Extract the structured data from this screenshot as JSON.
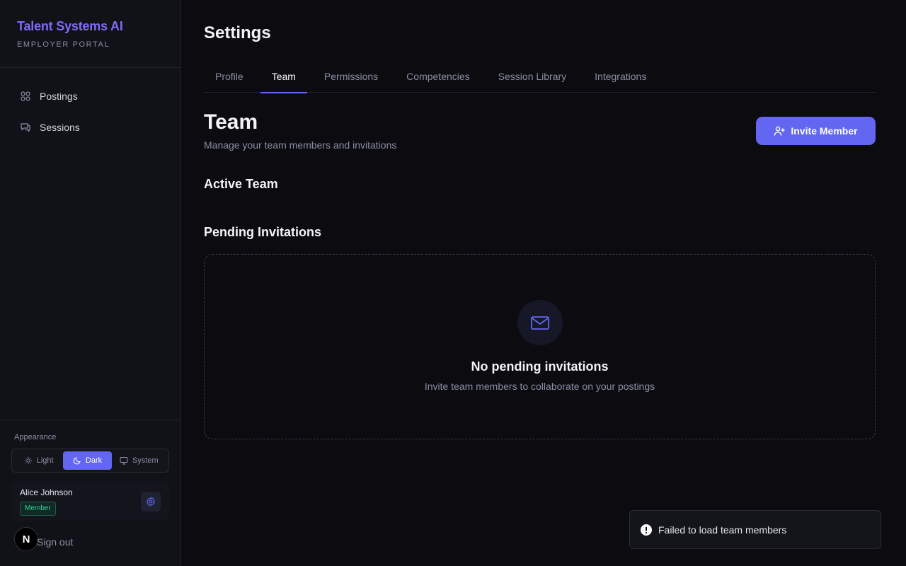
{
  "brand": {
    "title": "Talent Systems AI",
    "subtitle": "EMPLOYER PORTAL"
  },
  "sidebar": {
    "items": [
      {
        "label": "Postings",
        "icon": "grid-icon"
      },
      {
        "label": "Sessions",
        "icon": "chat-icon"
      }
    ]
  },
  "appearance": {
    "label": "Appearance",
    "options": [
      {
        "label": "Light",
        "icon": "sun-icon"
      },
      {
        "label": "Dark",
        "icon": "moon-icon"
      },
      {
        "label": "System",
        "icon": "monitor-icon"
      }
    ],
    "selected": "Dark"
  },
  "user": {
    "name": "Alice Johnson",
    "role": "Member"
  },
  "signout": "Sign out",
  "next_badge": "N",
  "page": {
    "title": "Settings"
  },
  "tabs": [
    "Profile",
    "Team",
    "Permissions",
    "Competencies",
    "Session Library",
    "Integrations"
  ],
  "active_tab": "Team",
  "team": {
    "title": "Team",
    "subtitle": "Manage your team members and invitations",
    "invite_label": "Invite Member",
    "active_heading": "Active Team",
    "pending_heading": "Pending Invitations",
    "empty_title": "No pending invitations",
    "empty_subtitle": "Invite team members to collaborate on your postings"
  },
  "toast": {
    "message": "Failed to load team members"
  },
  "colors": {
    "accent": "#6366f1",
    "brand": "#7c6cf6",
    "member_badge": "#34d399",
    "background": "#0b0b10"
  }
}
